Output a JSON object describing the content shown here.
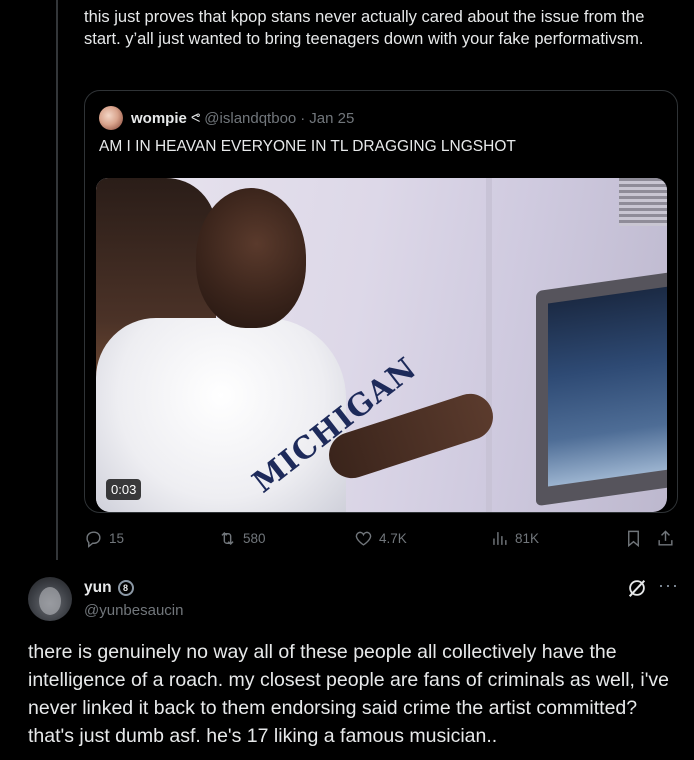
{
  "tweet1": {
    "text": "this just proves that kpop stans never actually cared about the issue from the start. y’all just wanted to bring teenagers down with your fake performativsm.",
    "quote": {
      "name": "wompie",
      "badge": "ᕙ",
      "handle": "@islandqtboo",
      "dot": "·",
      "date": "Jan 25",
      "text": "AM I IN HEAVAN EVERYONE IN TL DRAGGING LNGSHOT",
      "video": {
        "duration": "0:03",
        "shirt_text": "MICHIGAN"
      }
    },
    "actions": {
      "replies": "15",
      "reposts": "580",
      "likes": "4.7K",
      "views": "81K"
    }
  },
  "tweet2": {
    "name": "yun",
    "badge": "8",
    "handle": "@yunbesaucin",
    "more": "···",
    "text": "there is genuinely no way all of these people all collectively have the intelligence of a roach. my closest people are fans of criminals as well, i've never linked it back to them endorsing said crime the artist committed? that's just dumb asf. he's 17 liking a famous musician.."
  },
  "icons": {
    "reply": "reply-icon",
    "repost": "repost-icon",
    "like": "like-icon",
    "views": "views-icon",
    "bookmark": "bookmark-icon",
    "share": "share-icon",
    "grok": "grok-icon",
    "more": "more-icon"
  },
  "colors": {
    "background": "#000000",
    "text": "#e7e9ea",
    "muted": "#71767b",
    "border": "#2f3336"
  }
}
